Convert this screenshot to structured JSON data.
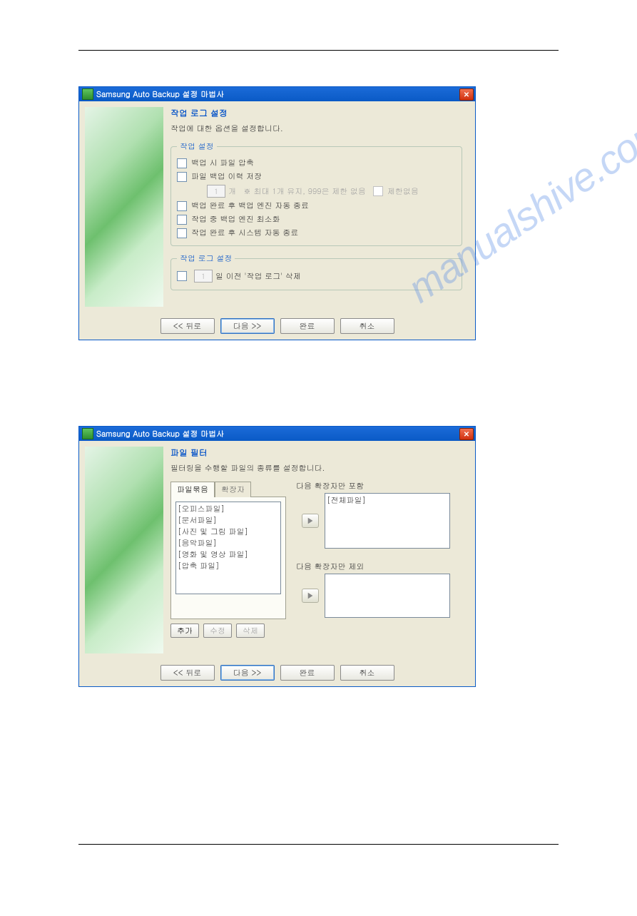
{
  "watermark": "manualshive.com",
  "dialog1": {
    "title": "Samsung Auto Backup 설정 마법사",
    "heading": "작업 로그 설정",
    "desc": "작업에 대한 옵션을 설정합니다.",
    "group1_legend": "작업 설정",
    "opt1": "백업 시 파일 압축",
    "opt2": "파일 백업 이력 저장",
    "spin_val": "1",
    "spin_unit": "개",
    "spin_note": "※ 최대 1개 유지, 999은 제한 없음",
    "spin_nolimit": "제한없음",
    "opt3": "백업 완료 후 백업 엔진 자동 종료",
    "opt4": "작업 중 백업 엔진 최소화",
    "opt5": "작업 완료 후 시스템 자동 종료",
    "group2_legend": "작업 로그 설정",
    "log_spin": "1",
    "log_label": "일 이전 '작업 로그' 삭제",
    "buttons": {
      "back": "<< 뒤로",
      "next": "다음 >>",
      "finish": "완료",
      "cancel": "취소"
    }
  },
  "dialog2": {
    "title": "Samsung Auto Backup 설정 마법사",
    "heading": "파일 필터",
    "desc": "필터링을 수행할 파일의 종류를 설정합니다.",
    "tab1": "파일묶음",
    "tab2": "확장자",
    "items": [
      "[오피스파일]",
      "[문서파일]",
      "[사진 및 그림 파일]",
      "[음악파일]",
      "[영화 및 영상 파일]",
      "[압축 파일]"
    ],
    "add": "추가",
    "edit": "수정",
    "del": "삭제",
    "include_label": "다음 확장자만 포함",
    "include_item": "[전체파일]",
    "exclude_label": "다음 확장자만 제외",
    "buttons": {
      "back": "<< 뒤로",
      "next": "다음 >>",
      "finish": "완료",
      "cancel": "취소"
    }
  }
}
